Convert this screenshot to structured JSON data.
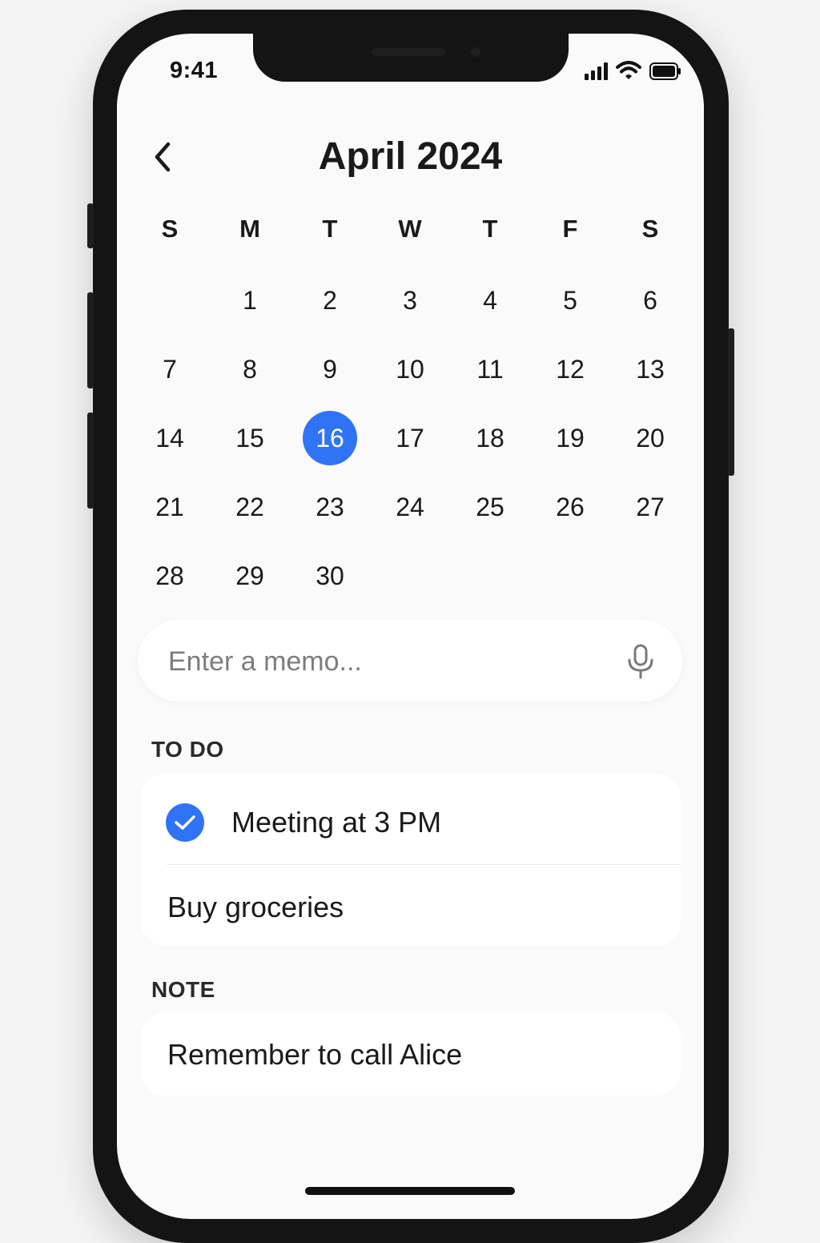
{
  "status_bar": {
    "time": "9:41",
    "icons": [
      "signal-icon",
      "wifi-icon",
      "battery-icon"
    ]
  },
  "header": {
    "title": "April 2024",
    "back_icon": "chevron-left-icon"
  },
  "calendar": {
    "weekdays": [
      "S",
      "M",
      "T",
      "W",
      "T",
      "F",
      "S"
    ],
    "first_weekday_offset": 1,
    "days": [
      "1",
      "2",
      "3",
      "4",
      "5",
      "6",
      "7",
      "8",
      "9",
      "10",
      "11",
      "12",
      "13",
      "14",
      "15",
      "16",
      "17",
      "18",
      "19",
      "20",
      "21",
      "22",
      "23",
      "24",
      "25",
      "26",
      "27",
      "28",
      "29",
      "30"
    ],
    "selected_day": "16",
    "accent_color": "#2f73f6"
  },
  "memo": {
    "placeholder": "Enter a memo...",
    "value": "",
    "icon": "microphone-icon"
  },
  "todo": {
    "label": "TO DO",
    "items": [
      {
        "text": "Meeting at 3 PM",
        "checked": true
      },
      {
        "text": "Buy groceries",
        "checked": false
      }
    ]
  },
  "note": {
    "label": "NOTE",
    "text": "Remember to call Alice"
  }
}
